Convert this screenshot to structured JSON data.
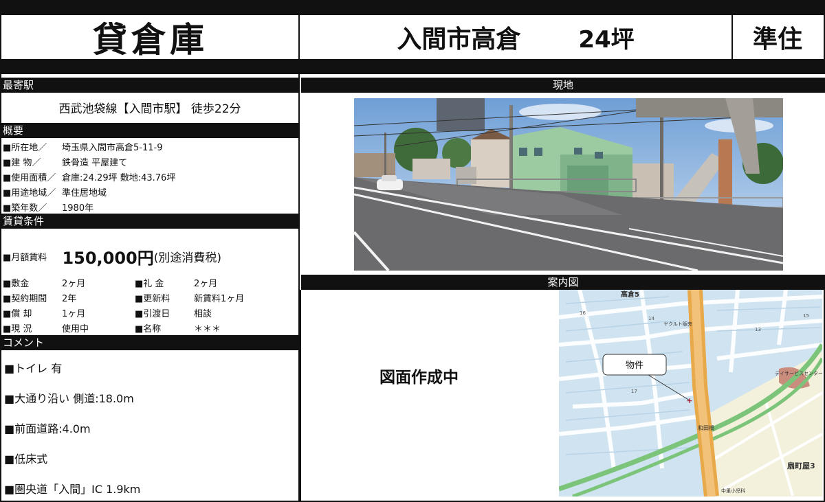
{
  "header": {
    "type": "貸倉庫",
    "location": "入間市高倉",
    "size": "24坪",
    "zoning_short": "準住"
  },
  "station": {
    "title": "最寄駅",
    "value": "西武池袋線【入間市駅】 徒歩22分"
  },
  "overview": {
    "title": "概要",
    "items": [
      {
        "label": "■所在地／",
        "value": "埼玉県入間市高倉5-11-9"
      },
      {
        "label": "■建 物／",
        "value": "鉄骨造 平屋建て"
      },
      {
        "label": "■使用面積／",
        "value": "倉庫:24.29坪 敷地:43.76坪"
      },
      {
        "label": "■用途地域／",
        "value": "準住居地域"
      },
      {
        "label": "■築年数／",
        "value": "1980年"
      }
    ]
  },
  "terms": {
    "title": "賃貸条件",
    "rent_label": "■月額賃料",
    "rent_value": "150,000円",
    "rent_note": "(別途消費税)",
    "items_left": [
      {
        "label": "■敷金",
        "value": "2ヶ月"
      },
      {
        "label": "■契約期間",
        "value": "2年"
      },
      {
        "label": "■償 却",
        "value": "1ヶ月"
      },
      {
        "label": "■現 況",
        "value": "使用中"
      }
    ],
    "items_right": [
      {
        "label": "■礼 金",
        "value": "2ヶ月"
      },
      {
        "label": "■更新料",
        "value": "新賃料1ヶ月"
      },
      {
        "label": "■引渡日",
        "value": "相談"
      },
      {
        "label": "■名称",
        "value": "＊＊＊"
      }
    ]
  },
  "comment": {
    "title": "コメント",
    "lines": [
      "■トイレ 有",
      "■大通り沿い 側道:18.0m",
      "■前面道路:4.0m",
      "■低床式",
      "■圏央道「入間」IC 1.9km"
    ]
  },
  "photo": {
    "title": "現地"
  },
  "guide": {
    "title": "案内図",
    "floorplan_status": "図面作成中",
    "map": {
      "area_top": "高倉5",
      "area_bottom_right": "扇町屋3",
      "bridge": "和田橋",
      "shop1": "ヤクルト販売",
      "shop2": "デイサービスセンター",
      "clinic": "中里小児科",
      "num16": "16",
      "num14": "14",
      "num15": "15",
      "num13": "13",
      "num17": "17",
      "callout": "物件"
    }
  },
  "colors": {
    "bar": "#111111",
    "water": "#cfe3f0",
    "green": "#7cc47a",
    "road": "#e8a94a"
  }
}
